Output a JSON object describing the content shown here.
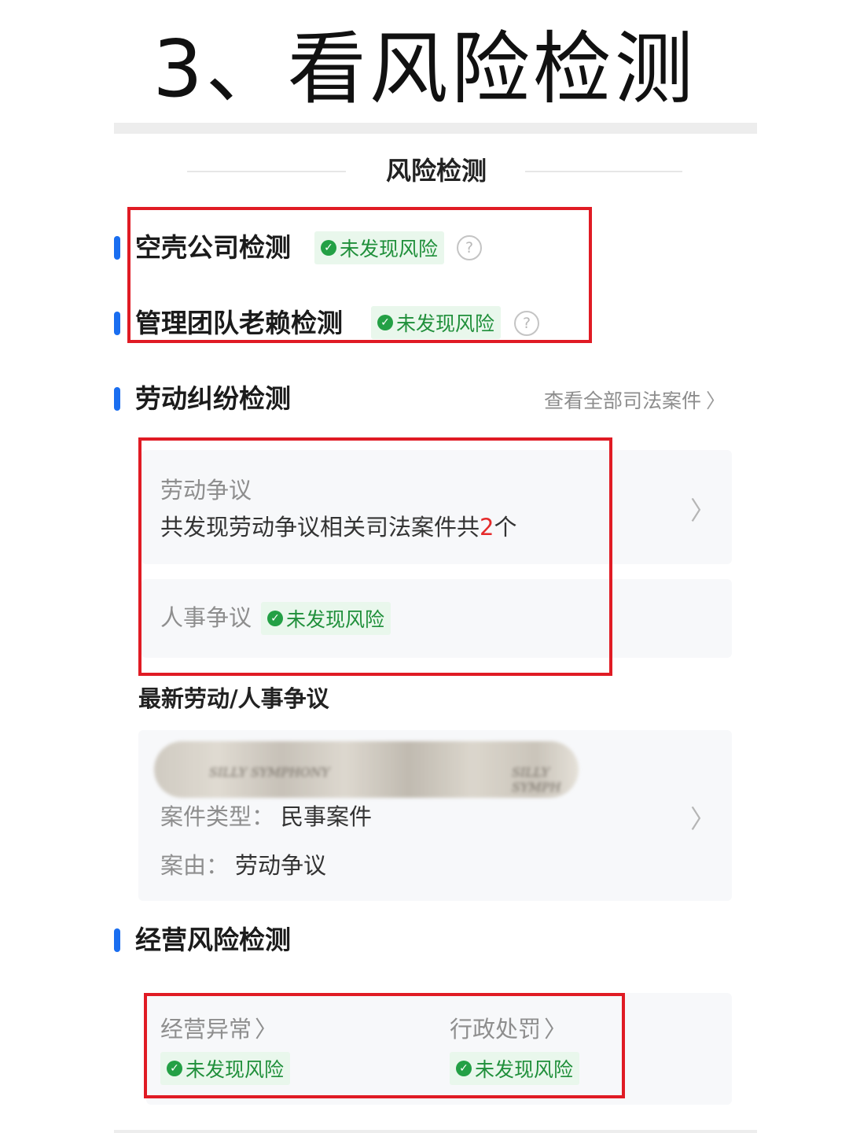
{
  "big_title": "3、看风险检测",
  "section_title": "风险检测",
  "shell_check": {
    "title": "空壳公司检测",
    "badge": "未发现风险",
    "help": "?"
  },
  "mgmt_check": {
    "title": "管理团队老赖检测",
    "badge": "未发现风险",
    "help": "?"
  },
  "labor": {
    "title": "劳动纠纷检测",
    "view_all": "查看全部司法案件",
    "dispute": {
      "label": "劳动争议",
      "text_prefix": "共发现劳动争议相关司法案件共",
      "count": "2",
      "text_suffix": "个"
    },
    "personnel": {
      "label": "人事争议",
      "badge": "未发现风险"
    },
    "latest_title": "最新劳动/人事争议",
    "latest_case": {
      "blur_text_1": "SILLY SYMPHONY",
      "blur_text_2": "SILLY SYMPH",
      "type_label": "案件类型：",
      "type_value": "民事案件",
      "cause_label": "案由：",
      "cause_value": "劳动争议"
    }
  },
  "business": {
    "title": "经营风险检测",
    "abnormal": {
      "label": "经营异常",
      "badge": "未发现风险"
    },
    "penalty": {
      "label": "行政处罚",
      "badge": "未发现风险"
    }
  },
  "icons": {
    "check": "check-circle-icon",
    "chevron": "chevron-right-icon",
    "help": "question-circle-icon"
  },
  "colors": {
    "accent": "#1a6ef0",
    "highlight_box": "#e01b24",
    "safe_green": "#1f8f3a",
    "count_red": "#e52a2a"
  }
}
